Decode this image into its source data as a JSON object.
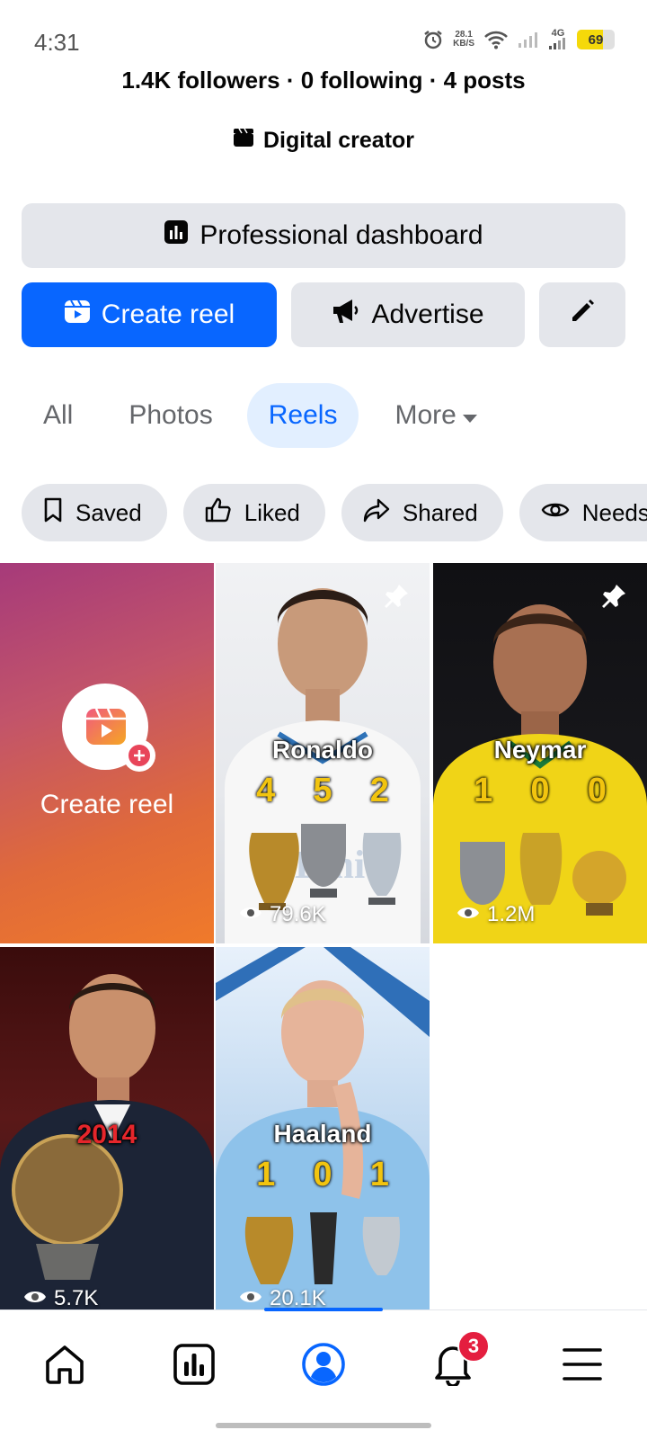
{
  "status_bar": {
    "time": "4:31",
    "net_speed_value": "28.1",
    "net_speed_unit": "KB/S",
    "network_type": "4G",
    "battery_level": "69",
    "battery_fraction": 0.69
  },
  "profile": {
    "stats": "1.4K followers · 0 following · 4 posts",
    "category": "Digital creator"
  },
  "actions": {
    "dashboard_label": "Professional dashboard",
    "create_reel_label": "Create reel",
    "advertise_label": "Advertise"
  },
  "tabs": [
    {
      "label": "All",
      "active": false
    },
    {
      "label": "Photos",
      "active": false
    },
    {
      "label": "Reels",
      "active": true
    },
    {
      "label": "More",
      "active": false
    }
  ],
  "filters": [
    {
      "label": "Saved",
      "icon": "bookmark-icon"
    },
    {
      "label": "Liked",
      "icon": "thumbs-up-icon"
    },
    {
      "label": "Shared",
      "icon": "share-icon"
    },
    {
      "label": "Needs",
      "icon": "eye-icon"
    }
  ],
  "grid": {
    "create_reel_label": "Create reel",
    "reels": [
      {
        "overlay_title": "Ronaldo",
        "numbers": [
          "4",
          "5",
          "2"
        ],
        "views": "79.6K",
        "pinned": true
      },
      {
        "overlay_title": "Neymar",
        "numbers": [
          "1",
          "0",
          "0"
        ],
        "views": "1.2M",
        "pinned": true
      },
      {
        "overlay_title": "2014",
        "numbers": [],
        "views": "5.7K",
        "pinned": false
      },
      {
        "overlay_title": "Haaland",
        "numbers": [
          "1",
          "0",
          "1"
        ],
        "views": "20.1K",
        "pinned": false
      }
    ]
  },
  "bottom_nav": {
    "items": [
      "home-icon",
      "chart-icon",
      "profile-icon",
      "bell-icon",
      "menu-icon"
    ],
    "active": "profile-icon",
    "notification_count": "3"
  },
  "colors": {
    "accent": "#0866ff",
    "badge": "#e41e3f",
    "chip_bg": "#e4e6eb",
    "active_tab_bg": "#e2efff"
  }
}
